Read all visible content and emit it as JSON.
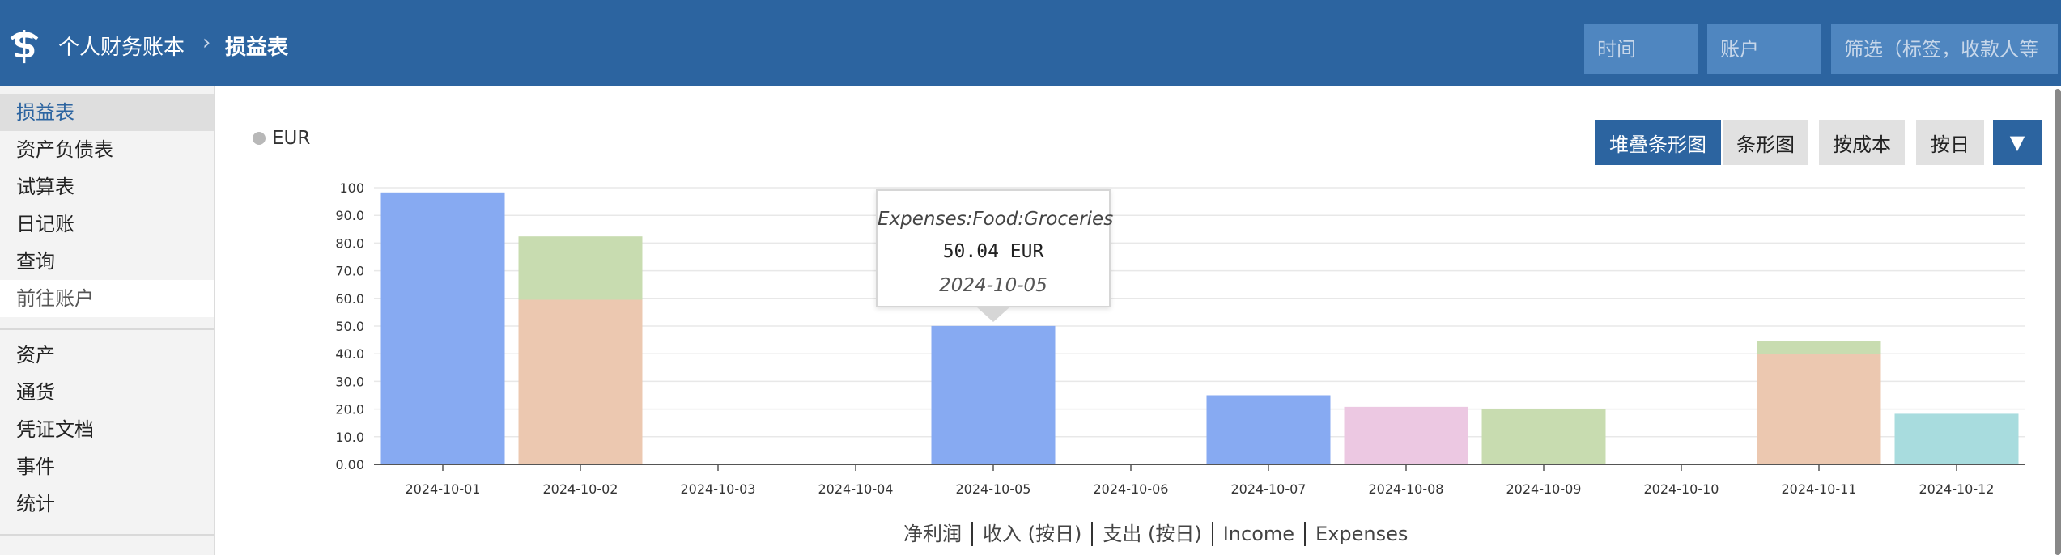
{
  "header": {
    "app_title": "个人财务账本",
    "separator": "›",
    "page_title": "损益表",
    "time_placeholder": "时间",
    "account_placeholder": "账户",
    "filter_placeholder": "筛选（标签，收款人等"
  },
  "sidebar": {
    "items": [
      {
        "label": "损益表",
        "state": "active"
      },
      {
        "label": "资产负债表"
      },
      {
        "label": "试算表"
      },
      {
        "label": "日记账"
      },
      {
        "label": "查询"
      },
      {
        "label": "前往账户",
        "state": "muted"
      },
      {
        "label": "资产"
      },
      {
        "label": "通货"
      },
      {
        "label": "凭证文档"
      },
      {
        "label": "事件"
      },
      {
        "label": "统计"
      }
    ]
  },
  "currency_legend": "EUR",
  "mode_buttons": {
    "stacked": "堆叠条形图",
    "bar": "条形图",
    "cost": "按成本",
    "day": "按日",
    "more": "▼"
  },
  "tooltip": {
    "account": "Expenses:Food:Groceries",
    "amount": "50.04 EUR",
    "date": "2024-10-05"
  },
  "bottom_legend": [
    "净利润",
    "收入 (按日)",
    "支出 (按日)",
    "Income",
    "Expenses"
  ],
  "colors": {
    "header_bg": "#2c64a0",
    "blue": "#87aaf2",
    "orange": "#ecc8b0",
    "green": "#c8dcb0",
    "pink": "#ecc8e2",
    "teal": "#a8dcde"
  },
  "chart_data": {
    "type": "bar",
    "stacked": true,
    "categories": [
      "2024-10-01",
      "2024-10-02",
      "2024-10-03",
      "2024-10-04",
      "2024-10-05",
      "2024-10-06",
      "2024-10-07",
      "2024-10-08",
      "2024-10-09",
      "2024-10-10",
      "2024-10-11",
      "2024-10-12"
    ],
    "y_ticks": [
      "0.00",
      "10.0",
      "20.0",
      "30.0",
      "40.0",
      "50.0",
      "60.0",
      "70.0",
      "80.0",
      "90.0",
      "100"
    ],
    "ylim": [
      0,
      100
    ],
    "grid": true,
    "stacks": [
      [
        {
          "value": 98.3,
          "color": "blue"
        }
      ],
      [
        {
          "value": 59.5,
          "color": "orange"
        },
        {
          "value": 22.9,
          "color": "green"
        }
      ],
      [],
      [],
      [
        {
          "value": 50.04,
          "color": "blue"
        }
      ],
      [],
      [
        {
          "value": 25.0,
          "color": "blue"
        }
      ],
      [
        {
          "value": 20.8,
          "color": "pink"
        }
      ],
      [
        {
          "value": 20.0,
          "color": "green"
        }
      ],
      [],
      [
        {
          "value": 40.0,
          "color": "orange"
        },
        {
          "value": 4.6,
          "color": "green"
        }
      ],
      [
        {
          "value": 18.3,
          "color": "teal"
        }
      ]
    ]
  }
}
